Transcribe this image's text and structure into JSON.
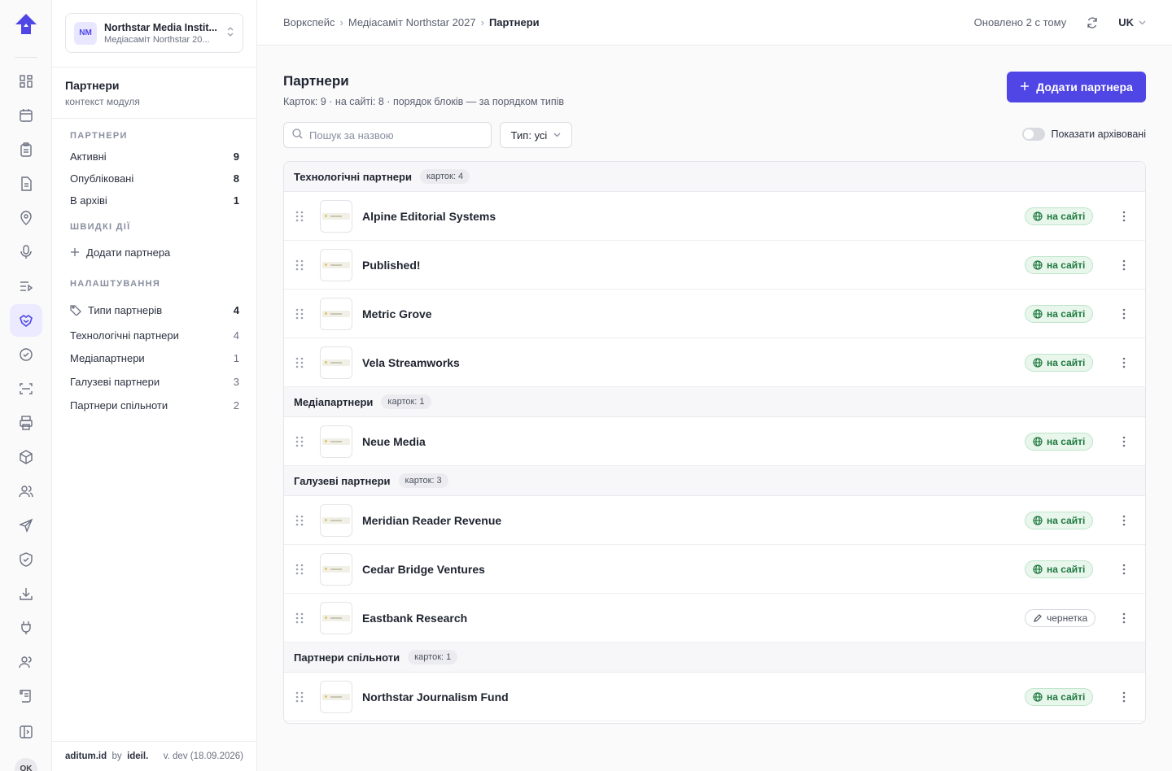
{
  "rail": {
    "icons": [
      "logo-icon",
      "dashboard-icon",
      "calendar-icon",
      "clipboard-icon",
      "document-icon",
      "location-icon",
      "microphone-icon",
      "agenda-icon",
      "partners-icon",
      "check-circle-icon",
      "scan-icon",
      "printer-icon",
      "package-icon",
      "users-icon",
      "send-icon",
      "shield-icon",
      "download-icon",
      "plug-icon",
      "team-icon",
      "scroll-icon",
      "sidebar-toggle-icon"
    ],
    "active": "partners-icon",
    "user_initials": "OK"
  },
  "org": {
    "initials": "NM",
    "name": "Northstar Media Instit...",
    "subtitle": "Медіасаміт Northstar 20..."
  },
  "sidebar": {
    "title": "Партнери",
    "subtitle": "контекст модуля",
    "section_partners": "ПАРТНЕРИ",
    "partners": [
      {
        "label": "Активні",
        "count": "9"
      },
      {
        "label": "Опубліковані",
        "count": "8"
      },
      {
        "label": "В архіві",
        "count": "1"
      }
    ],
    "section_quick": "ШВИДКІ ДІЇ",
    "quick_add": "Додати партнера",
    "section_settings": "НАЛАШТУВАННЯ",
    "settings_types": {
      "label": "Типи партнерів",
      "count": "4"
    },
    "types": [
      {
        "label": "Технологічні партнери",
        "count": "4"
      },
      {
        "label": "Медіапартнери",
        "count": "1"
      },
      {
        "label": "Галузеві партнери",
        "count": "3"
      },
      {
        "label": "Партнери спільноти",
        "count": "2"
      }
    ],
    "footer_brand": "aditum.id",
    "footer_by": "by",
    "footer_maker": "ideil.",
    "footer_version": "v. dev (18.09.2026)"
  },
  "topbar": {
    "crumbs": [
      "Воркспейс",
      "Медіасаміт Northstar 2027",
      "Партнери"
    ],
    "crumb_sep": "›",
    "updated": "Оновлено 2 с тому",
    "lang": "UK"
  },
  "page": {
    "title": "Партнери",
    "subtitle": "Карток: 9 · на сайті: 8 · порядок блоків — за порядком типів",
    "add_button": "Додати партнера",
    "search_placeholder": "Пошук за назвою",
    "type_filter": "Тип: усі",
    "archive_toggle": "Показати архівовані"
  },
  "groups": [
    {
      "name": "Технологічні партнери",
      "count": "карток: 4",
      "items": [
        {
          "name": "Alpine Editorial Systems",
          "status": "на сайті",
          "kind": "live"
        },
        {
          "name": "Published!",
          "status": "на сайті",
          "kind": "live"
        },
        {
          "name": "Metric Grove",
          "status": "на сайті",
          "kind": "live"
        },
        {
          "name": "Vela Streamworks",
          "status": "на сайті",
          "kind": "live"
        }
      ]
    },
    {
      "name": "Медіапартнери",
      "count": "карток: 1",
      "items": [
        {
          "name": "Neue Media",
          "status": "на сайті",
          "kind": "live"
        }
      ]
    },
    {
      "name": "Галузеві партнери",
      "count": "карток: 3",
      "items": [
        {
          "name": "Meridian Reader Revenue",
          "status": "на сайті",
          "kind": "live"
        },
        {
          "name": "Cedar Bridge Ventures",
          "status": "на сайті",
          "kind": "live"
        },
        {
          "name": "Eastbank Research",
          "status": "чернетка",
          "kind": "draft"
        }
      ]
    },
    {
      "name": "Партнери спільноти",
      "count": "карток: 1",
      "items": [
        {
          "name": "Northstar Journalism Fund",
          "status": "на сайті",
          "kind": "live"
        }
      ]
    }
  ],
  "colors": {
    "accent": "#4f46e5",
    "live": "#1f7a3f",
    "live_bg": "#e8f6ec"
  }
}
